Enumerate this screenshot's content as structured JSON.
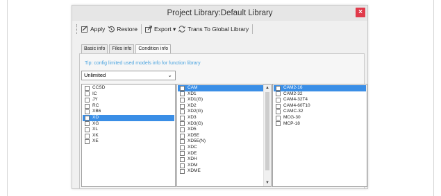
{
  "window": {
    "title": "Project Library:Default Library",
    "close_glyph": "×"
  },
  "toolbar": {
    "apply_label": "Apply",
    "restore_label": "Restore",
    "export_label": "Export ▾",
    "trans_label": "Trans To Global Library"
  },
  "tabs": [
    "Basic info",
    "Files info",
    "Condition info"
  ],
  "active_tab": "Condition info",
  "tip": "Tip: config limited used models info for function library",
  "combo": {
    "value": "Unlimited"
  },
  "list_left": {
    "items": [
      "CCSD",
      "IC",
      "JY",
      "RC",
      "XB6",
      "XD",
      "XG",
      "XL",
      "XK",
      "XE"
    ],
    "selected": "XD"
  },
  "list_middle": {
    "items": [
      "CAM",
      "XD1",
      "XD1(G)",
      "XD2",
      "XD2(G)",
      "XD3",
      "XD3(G)",
      "XD5",
      "XD5E",
      "XD5E(N)",
      "XDC",
      "XDE",
      "XDH",
      "XDM",
      "XDME"
    ],
    "selected": "CAM"
  },
  "list_right": {
    "items": [
      "CAM2-16",
      "CAM2-32",
      "CAM4-32T4",
      "CAM4-60T10",
      "CAMC-32",
      "MCG-30",
      "MCP-18"
    ],
    "selected": "CAM2-16"
  },
  "colors": {
    "accent": "#3a8ee6",
    "close": "#e03a4a",
    "tip": "#4aa3df"
  }
}
